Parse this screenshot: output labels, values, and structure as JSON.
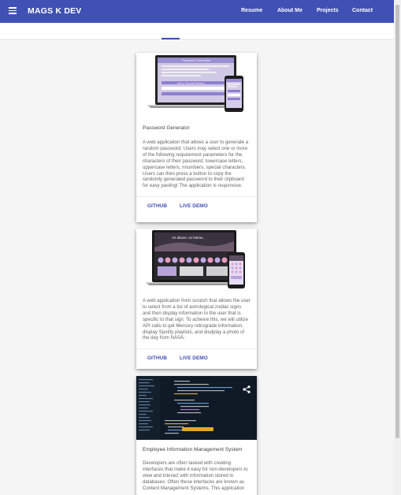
{
  "appbar": {
    "brand": "MAGS K DEV",
    "nav": [
      "Resume",
      "About Me",
      "Projects",
      "Contact"
    ],
    "color": "#3f51b5"
  },
  "cards": [
    {
      "title": "Password Generator",
      "description": "A web application that allows a user to generate a random password. Users may select one or more of the following requirement parameters for the characters of their password: lowercase letters, uppercase letters, nnumbers, special characters. Users can then press a button to copy the randomly generated password to their clipboard for easy pasting! The application is responsive.",
      "actions": [
        "GITHUB",
        "LIVE DEMO"
      ]
    },
    {
      "title": "",
      "description": "A web application from scratch that allows the user to select from a list of astrological zodiac signs and then display information to the user that is specific to that sign. To acheive this, we will utilize API calls to get Mercury retrograde information, display Spotify playlists, and disdplay a photo of the day from NASA.",
      "actions": [
        "GITHUB",
        "LIVE DEMO"
      ]
    },
    {
      "title": "Employee Information Management System",
      "description": "Developers are often tasked with creating interfaces that make it easy for non-developers to view and interact with information stored in databases. Often these interfaces are known as Content Management Systems. This application"
    }
  ],
  "mockups": {
    "password_screen_title": "Password Generator",
    "password_button": "Click to Generate Password",
    "zodiac_headline": "As above, so below..."
  }
}
